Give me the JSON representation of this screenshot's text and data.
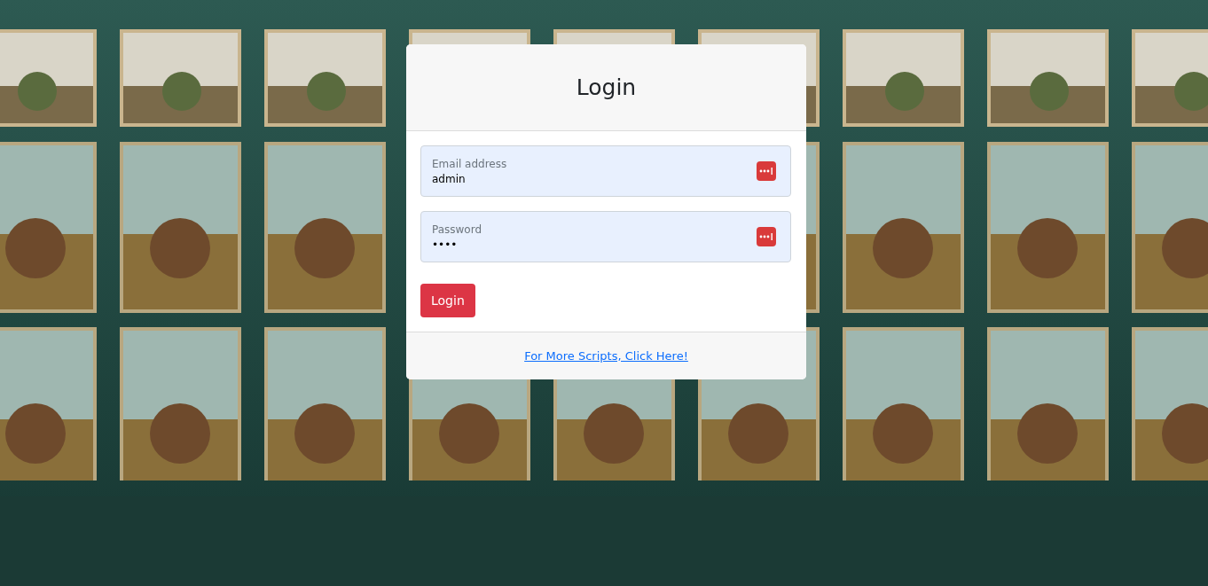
{
  "card": {
    "title": "Login",
    "fields": [
      {
        "label": "Email address",
        "value": "admin"
      },
      {
        "label": "Password",
        "value": "••••"
      }
    ],
    "button": "Login",
    "footer_link": "For More Scripts, Click Here!"
  }
}
